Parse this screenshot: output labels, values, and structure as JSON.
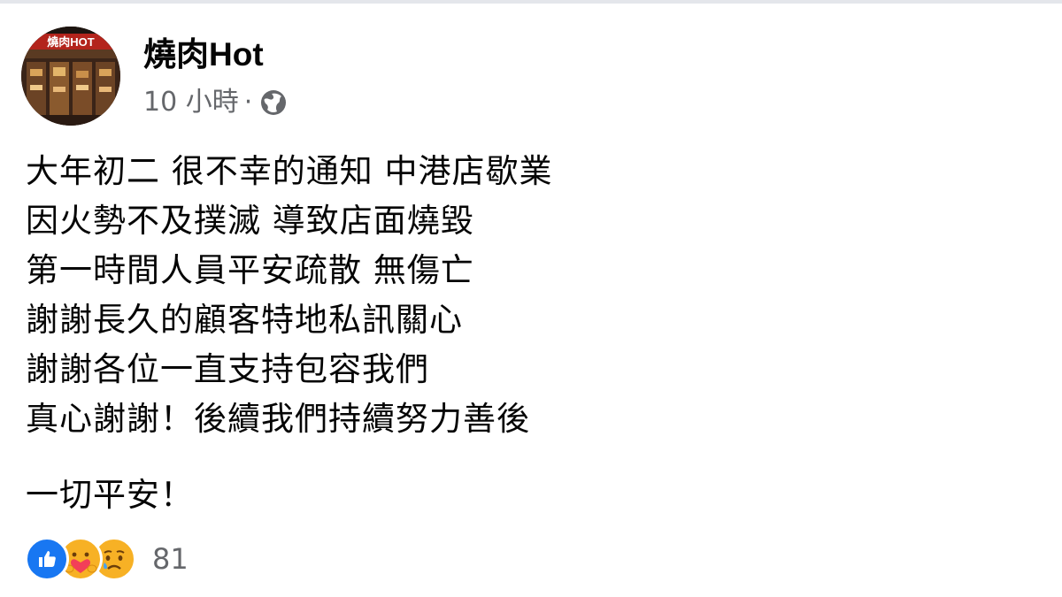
{
  "post": {
    "page_name": "燒肉Hot",
    "timestamp": "10 小時",
    "separator": "·",
    "privacy_icon": "globe-icon",
    "avatar_sign_text": "燒肉HOT",
    "lines": [
      "大年初二 很不幸的通知 中港店歇業",
      "因火勢不及撲滅 導致店面燒毀",
      "第一時間人員平安疏散 無傷亡",
      "謝謝長久的顧客特地私訊關心",
      "謝謝各位一直支持包容我們",
      "真心謝謝！後續我們持續努力善後"
    ],
    "closing": "一切平安！"
  },
  "reactions": {
    "icons": [
      "like-icon",
      "care-icon",
      "sad-icon"
    ],
    "count": "81"
  },
  "colors": {
    "like_blue": "#1877f2",
    "care_red": "#f33e58",
    "sad_yellow": "#f7b125",
    "secondary_text": "#65676b"
  }
}
